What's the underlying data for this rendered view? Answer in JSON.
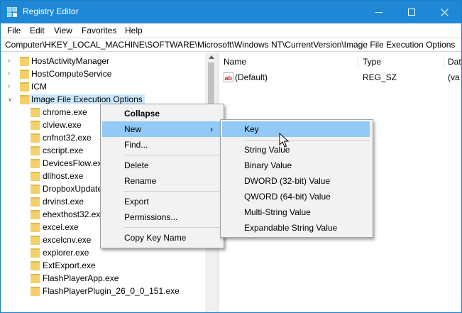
{
  "window": {
    "title": "Registry Editor",
    "accent_color": "#1e88d6"
  },
  "menubar": [
    "File",
    "Edit",
    "View",
    "Favorites",
    "Help"
  ],
  "address": "Computer\\HKEY_LOCAL_MACHINE\\SOFTWARE\\Microsoft\\Windows NT\\CurrentVersion\\Image File Execution Options",
  "tree": {
    "parents": [
      {
        "label": "HostActivityManager",
        "chevron": "right"
      },
      {
        "label": "HostComputeService",
        "chevron": "right"
      },
      {
        "label": "ICM",
        "chevron": "right"
      },
      {
        "label": "Image File Execution Options",
        "chevron": "down",
        "selected": true
      }
    ],
    "children": [
      "chrome.exe",
      "clview.exe",
      "cnfnot32.exe",
      "cscript.exe",
      "DevicesFlow.exe",
      "dllhost.exe",
      "DropboxUpdate",
      "drvinst.exe",
      "ehexthost32.exe",
      "excel.exe",
      "excelcnv.exe",
      "explorer.exe",
      "ExtExport.exe",
      "FlashPlayerApp.exe",
      "FlashPlayerPlugin_26_0_0_151.exe"
    ]
  },
  "list": {
    "columns": [
      "Name",
      "Type",
      "Dat"
    ],
    "rows": [
      {
        "name": "(Default)",
        "type": "REG_SZ",
        "data": "(va"
      }
    ]
  },
  "context_menu": {
    "items": [
      "Collapse",
      "New",
      "Find...",
      "Delete",
      "Rename",
      "Export",
      "Permissions...",
      "Copy Key Name"
    ],
    "highlighted": "New"
  },
  "submenu": {
    "items": [
      "Key",
      "String Value",
      "Binary Value",
      "DWORD (32-bit) Value",
      "QWORD (64-bit) Value",
      "Multi-String Value",
      "Expandable String Value"
    ],
    "highlighted": "Key"
  },
  "icons": {
    "app": "registry-editor-icon",
    "folder": "folder-icon",
    "string_value": "ab-string-icon",
    "cursor": "mouse-pointer-icon"
  },
  "colors": {
    "menu_highlight": "#91c9f7",
    "tree_selection": "#cce8ff",
    "folder": "#f4d06b"
  }
}
